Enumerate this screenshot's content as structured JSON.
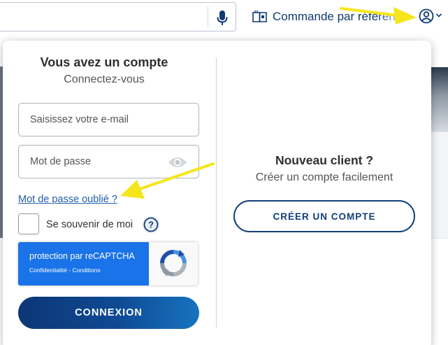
{
  "header": {
    "search_placeholder": "",
    "order_reference_label": "Commande par référence",
    "icons": [
      "microphone-icon",
      "catalog-book-icon",
      "account-circle-icon",
      "chevron-down-icon"
    ]
  },
  "login": {
    "title": "Vous avez un compte",
    "subtitle": "Connectez-vous",
    "email_placeholder": "Saisissez votre e-mail",
    "password_placeholder": "Mot de passe",
    "forgot_password": "Mot de passe oublié ?",
    "remember_me": "Se souvenir de moi",
    "help_glyph": "?",
    "login_button": "CONNEXION"
  },
  "recaptcha": {
    "title": "protection par reCAPTCHA",
    "privacy": "Confidentialité",
    "separator": " - ",
    "terms": "Conditions"
  },
  "new_client": {
    "title": "Nouveau client ?",
    "subtitle": "Créer un compte facilement",
    "create_button": "CRÉER UN COMPTE"
  },
  "colors": {
    "brand_navy": "#0d3676",
    "link_blue": "#1f5fa8",
    "recaptcha_blue": "#1a73e8",
    "annotation_yellow": "#f5e61c"
  }
}
